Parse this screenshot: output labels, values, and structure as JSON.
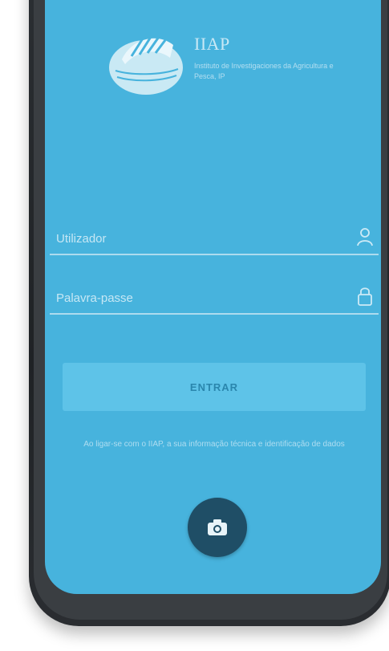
{
  "brand": {
    "title": "IIAP",
    "subtitle": "Instituto de Investigaciones da Agricultura e Pesca, IP"
  },
  "login": {
    "username_placeholder": "Utilizador",
    "password_placeholder": "Palavra-passe",
    "username_icon": "person-icon",
    "password_icon": "lock-icon",
    "submit_label": "ENTRAR",
    "info_text": "Ao ligar-se com o IIAP, a sua informação técnica e identificação de dados"
  },
  "actions": {
    "camera_icon": "camera-icon"
  },
  "colors": {
    "screen_background": "#47b3dd",
    "button_background": "#5ec3e8",
    "button_text": "#2a86ad",
    "camera_button": "#1f4e66",
    "phone_frame": "#2b2f33"
  }
}
